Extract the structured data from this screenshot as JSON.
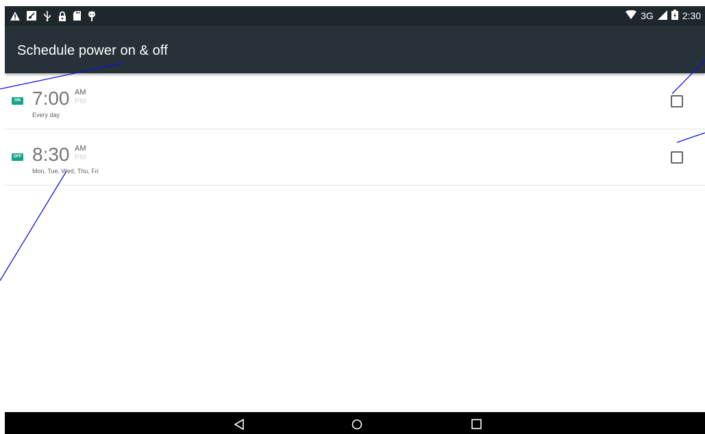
{
  "status_bar": {
    "left_icons": [
      "warning-icon",
      "no-sim-icon",
      "usb-icon",
      "lock-icon",
      "sd-card-icon",
      "android-debug-icon"
    ],
    "network": "3G",
    "time": "2:30"
  },
  "app_bar": {
    "title": "Schedule power on & off"
  },
  "schedules": [
    {
      "badge": "ON",
      "time": "7:00",
      "am": "AM",
      "pm": "PM",
      "days": "Every day",
      "checked": false
    },
    {
      "badge": "OFF",
      "time": "8:30",
      "am": "AM",
      "pm": "PM",
      "days": "Mon, Tue, Wed, Thu, Fri",
      "checked": false
    }
  ],
  "nav_bar": {
    "buttons": [
      "back-icon",
      "home-icon",
      "recents-icon"
    ]
  },
  "colors": {
    "status_bar": "#1e272c",
    "app_bar": "#263238",
    "badge": "#13a38a",
    "annotation": "#0000ff"
  }
}
